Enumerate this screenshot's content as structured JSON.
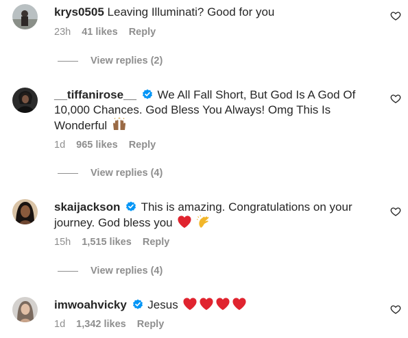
{
  "comments": [
    {
      "username": "krys0505",
      "verified": false,
      "text": "Leaving Illuminati? Good for you",
      "time": "23h",
      "likes": "41 likes",
      "reply": "Reply",
      "view_replies": "View replies (2)"
    },
    {
      "username": "__tiffanirose__",
      "verified": true,
      "text": "We All Fall Short, But God Is A God Of 10,000 Chances. God Bless You Always! Omg This Is Wonderful",
      "emoji": [
        "raising-hands-icon"
      ],
      "time": "1d",
      "likes": "965 likes",
      "reply": "Reply",
      "view_replies": "View replies (4)"
    },
    {
      "username": "skaijackson",
      "verified": true,
      "text": "This is amazing. Congratulations on your journey. God bless you",
      "emoji": [
        "red-heart-icon",
        "clapping-hands-icon"
      ],
      "time": "15h",
      "likes": "1,515 likes",
      "reply": "Reply",
      "view_replies": "View replies (4)"
    },
    {
      "username": "imwoahvicky",
      "verified": true,
      "text": "Jesus",
      "emoji": [
        "red-heart-icon",
        "red-heart-icon",
        "red-heart-icon",
        "red-heart-icon"
      ],
      "time": "1d",
      "likes": "1,342 likes",
      "reply": "Reply"
    }
  ],
  "colors": {
    "text": "#262626",
    "secondary": "#8e8e8e",
    "verified": "#0095f6",
    "heart": "#e0242f"
  }
}
